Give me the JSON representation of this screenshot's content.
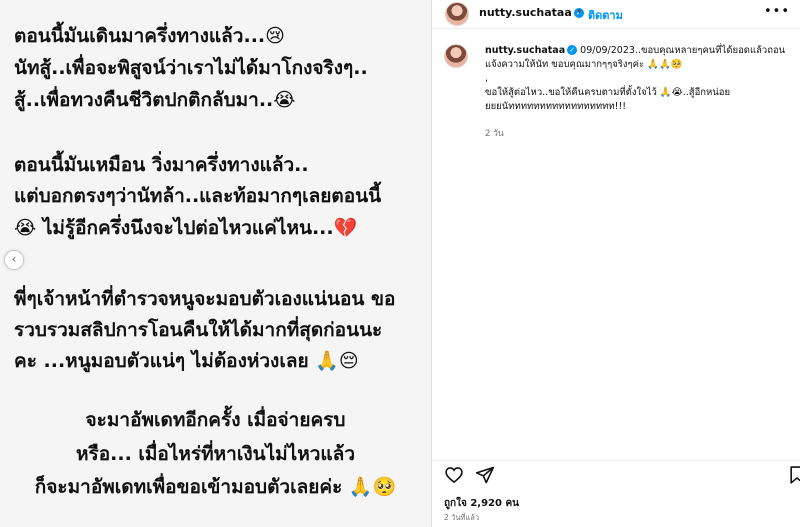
{
  "post_image": {
    "lines": [
      "ตอนนี้มันเดินมาครึ่งทางแล้ว...😢",
      "นัทสู้..เพื่อจะพิสูจน์ว่าเราไม่ได้มาโกงจริงๆ..",
      "สู้..เพื่อทวงคืนชีวิตปกติกลับมา..😭",
      "ตอนนี้มันเหมือน วิ่งมาครึ่งทางแล้ว..",
      "แต่บอกตรงๆว่านัทล้า..และท้อมากๆเลยตอนนี้",
      "😭 ไม่รู้อีกครึ่งนึงจะไปต่อไหวแค่ไหน...💔",
      "พี่ๆเจ้าหน้าที่ตำรวจหนูจะมอบตัวเองแน่นอน ขอ",
      "รวบรวมสลิปการโอนคืนให้ได้มากที่สุดก่อนนะ",
      "คะ ...หนูมอบตัวแน่ๆ ไม่ต้องห่วงเลย 🙏😔",
      "จะมาอัพเดทอีกครั้ง เมื่อจ่ายครบ",
      "หรือ... เมื่อไหร่ที่หาเงินไม่ไหวแล้ว",
      "ก็จะมาอัพเดทเพื่อขอเข้ามอบตัวเลยค่ะ 🙏🥺"
    ]
  },
  "header": {
    "username": "nutty.suchataa",
    "separator": "•",
    "follow_label": "ติดตาม",
    "more_icon": "more-horizontal-icon"
  },
  "caption": {
    "username": "nutty.suchataa",
    "date": "09/09/2023",
    "line1": "..ขอบคุณหลายๆคนที่ได้ยอดแล้วถอน",
    "line2": "แจ้งความให้นัท ขอบคุณมากๆๆจริงๆค่ะ 🙏🙏🥺",
    "line3": ",",
    "line4": "ขอให้สู้ต่อไหว..ขอให้คืนครบตามที่ตั้งใจไว้ 🙏😭..สู้อีกหน่อย",
    "line5": "ยยยนัททททททททททททททททท!!!",
    "time": "2 วัน"
  },
  "actions": {
    "like_icon": "heart-icon",
    "share_icon": "share-icon",
    "save_icon": "bookmark-icon"
  },
  "likes_text": "ถูกใจ 2,920 คน",
  "posted_ago": "2 วันที่แล้ว",
  "colors": {
    "accent": "#0095f6",
    "text": "#111111",
    "muted": "#737373",
    "image_bg": "#f5f5f5"
  }
}
